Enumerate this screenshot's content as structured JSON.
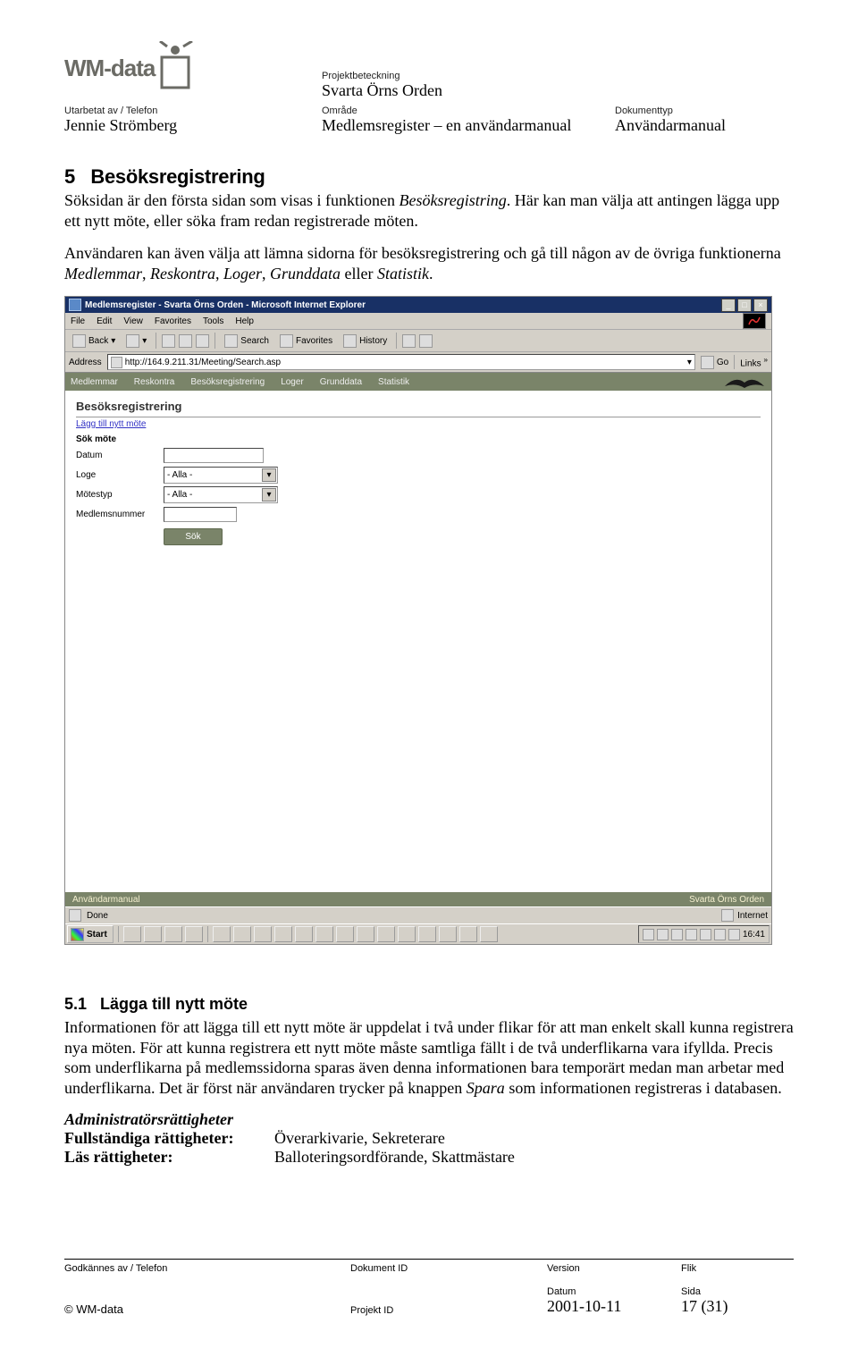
{
  "header": {
    "logo_text": "WM-data",
    "utarbetat_label": "Utarbetat av / Telefon",
    "utarbetat_value": "Jennie Strömberg",
    "projekt_label": "Projektbeteckning",
    "projekt_value": "Svarta Örns Orden",
    "omrade_label": "Område",
    "omrade_value": "Medlemsregister – en användarmanual",
    "doktyp_label": "Dokumenttyp",
    "doktyp_value": "Användarmanual"
  },
  "section": {
    "number": "5",
    "title": "Besöksregistrering",
    "para1a": "Söksidan är den första sidan som visas i funktionen ",
    "para1b_italic": "Besöksregistring",
    "para1c": ". Här kan man välja att antingen lägga upp ett nytt möte, eller söka fram redan registrerade möten.",
    "para2a": "Användaren kan även välja att lämna sidorna för besöksregistrering och gå till någon av de övriga funktionerna ",
    "para2b_italic": "Medlemmar",
    "para2c": ", ",
    "para2d_italic": "Reskontra",
    "para2e": ", ",
    "para2f_italic": "Loger",
    "para2g": ", ",
    "para2h_italic": "Grunddata",
    "para2i": " eller ",
    "para2j_italic": "Statistik",
    "para2k": "."
  },
  "screenshot": {
    "title": "Medlemsregister - Svarta Örns Orden - Microsoft Internet Explorer",
    "menu": [
      "File",
      "Edit",
      "View",
      "Favorites",
      "Tools",
      "Help"
    ],
    "toolbar": {
      "back": "Back",
      "search": "Search",
      "favorites": "Favorites",
      "history": "History"
    },
    "address_label": "Address",
    "address_value": "http://164.9.211.31/Meeting/Search.asp",
    "go_label": "Go",
    "links_label": "Links",
    "nav": [
      "Medlemmar",
      "Reskontra",
      "Besöksregistrering",
      "Loger",
      "Grunddata",
      "Statistik"
    ],
    "panel_title": "Besöksregistrering",
    "add_link": "Lägg till nytt möte",
    "sok_title": "Sök möte",
    "fields": {
      "datum": "Datum",
      "loge": "Loge",
      "motestyp": "Mötestyp",
      "medlnr": "Medlemsnummer",
      "alla": "- Alla -"
    },
    "sok_btn": "Sök",
    "footer_left": "Användarmanual",
    "footer_right": "Svarta Örns Orden",
    "status_done": "Done",
    "status_internet": "Internet",
    "start": "Start",
    "clock": "16:41"
  },
  "subsection": {
    "number": "5.1",
    "title": "Lägga till nytt möte",
    "para_a": "Informationen för att lägga till ett nytt möte är uppdelat i två under flikar för att man enkelt skall kunna registrera nya möten. För att kunna registrera ett nytt möte måste samtliga fällt i de två underflikarna vara ifyllda. Precis som underflikarna på medlemssidorna sparas även denna informationen bara temporärt medan man arbetar med underflikarna. Det är först när användaren trycker på knappen ",
    "para_b_italic": "Spara",
    "para_c": " som informationen registreras i databasen.",
    "admin_heading": "Administratörsrättigheter",
    "full_label": "Fullständiga rättigheter:",
    "full_value": "Överarkivarie, Sekreterare",
    "read_label": "Läs rättigheter:",
    "read_value": "Balloteringsordförande, Skattmästare"
  },
  "footer": {
    "godkannes": "Godkännes av / Telefon",
    "dokid": "Dokument ID",
    "version": "Version",
    "flik": "Flik",
    "projektid": "Projekt ID",
    "datum_label": "Datum",
    "datum_value": "2001-10-11",
    "sida_label": "Sida",
    "sida_value": "17 (31)",
    "copyright": "© WM-data"
  }
}
